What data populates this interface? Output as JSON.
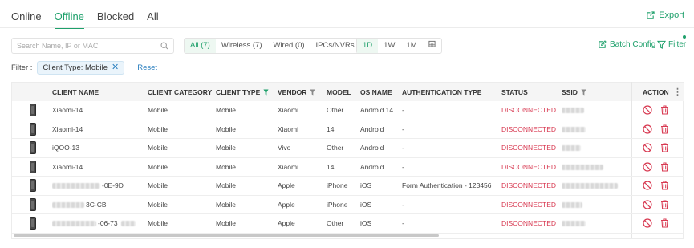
{
  "tabs": [
    {
      "label": "Online",
      "active": false
    },
    {
      "label": "Offline",
      "active": true
    },
    {
      "label": "Blocked",
      "active": false
    },
    {
      "label": "All",
      "active": false
    }
  ],
  "export_label": "Export",
  "search": {
    "placeholder": "Search Name, IP or MAC"
  },
  "type_filter": [
    {
      "label": "All (7)",
      "active": true
    },
    {
      "label": "Wireless (7)",
      "active": false
    },
    {
      "label": "Wired (0)",
      "active": false
    },
    {
      "label": "IPCs/NVRs",
      "active": false
    }
  ],
  "time_filter": [
    {
      "label": "1D",
      "active": true
    },
    {
      "label": "1W",
      "active": false
    },
    {
      "label": "1M",
      "active": false
    }
  ],
  "batch_config_label": "Batch Config",
  "filter_label": "Filter",
  "active_filters": {
    "label": "Filter :",
    "chip": "Client Type: Mobile",
    "reset_label": "Reset"
  },
  "table": {
    "headers": {
      "name": "CLIENT NAME",
      "category": "CLIENT CATEGORY",
      "type": "CLIENT TYPE",
      "vendor": "VENDOR",
      "model": "MODEL",
      "os": "OS NAME",
      "auth": "AUTHENTICATION TYPE",
      "status": "STATUS",
      "ssid": "SSID",
      "action": "ACTION"
    },
    "rows": [
      {
        "name": "Xiaomi-14",
        "category": "Mobile",
        "type": "Mobile",
        "vendor": "Xiaomi",
        "model": "Other",
        "os": "Android 14",
        "auth": "-",
        "status": "DISCONNECTED"
      },
      {
        "name": "Xiaomi-14",
        "category": "Mobile",
        "type": "Mobile",
        "vendor": "Xiaomi",
        "model": "14",
        "os": "Android",
        "auth": "-",
        "status": "DISCONNECTED"
      },
      {
        "name": "iQOO-13",
        "category": "Mobile",
        "type": "Mobile",
        "vendor": "Vivo",
        "model": "Other",
        "os": "Android",
        "auth": "-",
        "status": "DISCONNECTED"
      },
      {
        "name": "Xiaomi-14",
        "category": "Mobile",
        "type": "Mobile",
        "vendor": "Xiaomi",
        "model": "14",
        "os": "Android",
        "auth": "-",
        "status": "DISCONNECTED"
      },
      {
        "name": "-0E-9D",
        "category": "Mobile",
        "type": "Mobile",
        "vendor": "Apple",
        "model": "iPhone",
        "os": "iOS",
        "auth": "Form Authentication - 123456",
        "status": "DISCONNECTED"
      },
      {
        "name": "3C-CB",
        "category": "Mobile",
        "type": "Mobile",
        "vendor": "Apple",
        "model": "iPhone",
        "os": "iOS",
        "auth": "-",
        "status": "DISCONNECTED"
      },
      {
        "name": "-06-73",
        "category": "Mobile",
        "type": "Mobile",
        "vendor": "Apple",
        "model": "Other",
        "os": "iOS",
        "auth": "-",
        "status": "DISCONNECTED"
      }
    ]
  },
  "colors": {
    "accent": "#1ea06b",
    "danger": "#d83a52",
    "link": "#2a7fbf"
  }
}
